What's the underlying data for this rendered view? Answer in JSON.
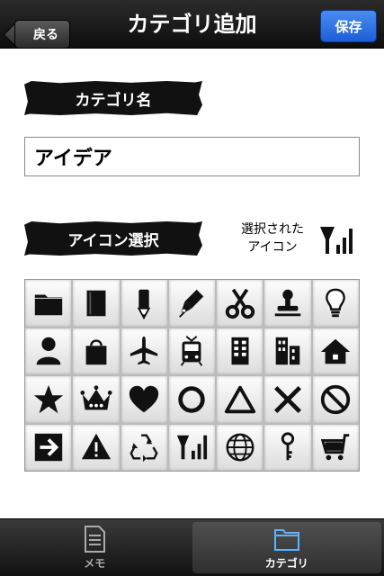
{
  "header": {
    "title": "カテゴリ追加",
    "back_label": "戻る",
    "save_label": "保存"
  },
  "category_name": {
    "heading": "カテゴリ名",
    "value": "アイデア"
  },
  "icon_select": {
    "heading": "アイコン選択",
    "selected_label": "選択された\nアイコン",
    "selected_icon": "signal-icon",
    "icons": [
      "folder-icon",
      "book-icon",
      "pencil-icon",
      "pen-nib-icon",
      "scissors-icon",
      "stamp-icon",
      "lightbulb-icon",
      "person-icon",
      "shopping-bag-icon",
      "airplane-icon",
      "train-icon",
      "building-icon",
      "buildings-icon",
      "home-icon",
      "star-icon",
      "crown-icon",
      "heart-icon",
      "circle-icon",
      "triangle-icon",
      "cross-icon",
      "prohibited-icon",
      "arrow-right-icon",
      "warning-icon",
      "recycle-icon",
      "signal-icon",
      "globe-icon",
      "key-icon",
      "cart-icon"
    ]
  },
  "tabbar": {
    "tabs": [
      {
        "label": "メモ",
        "icon": "memo-icon"
      },
      {
        "label": "カテゴリ",
        "icon": "folder-icon"
      }
    ]
  },
  "colors": {
    "save_button": "#2a6de0",
    "active_tab_icon": "#5ab4ff"
  }
}
